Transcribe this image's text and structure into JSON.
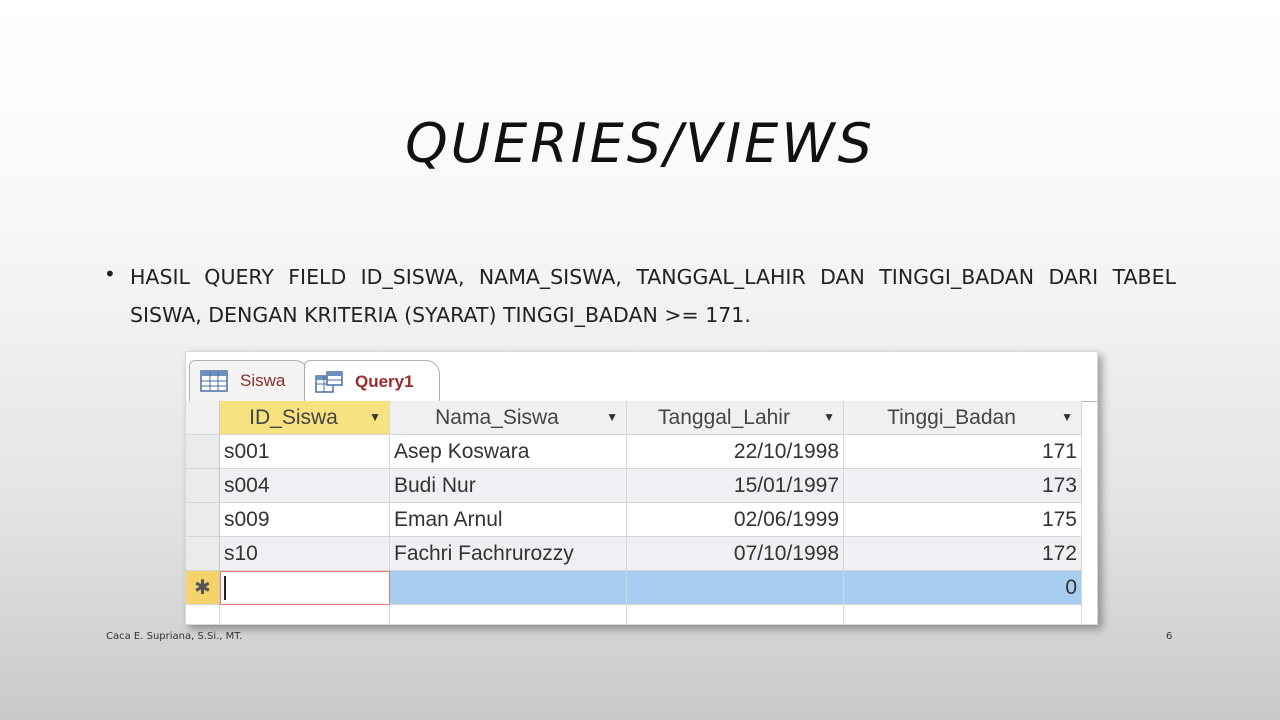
{
  "slide": {
    "title": "QUERIES/VIEWS",
    "bullet": "HASIL QUERY FIELD ID_SISWA, NAMA_SISWA, TANGGAL_LAHIR DAN TINGGI_BADAN DARI TABEL SISWA, DENGAN KRITERIA (SYARAT) TINGGI_BADAN >= 171.",
    "footer_author": "Caca E. Supriana, S.Si., MT.",
    "page_number": "6"
  },
  "access": {
    "tabs": [
      {
        "label": "Siswa",
        "icon": "table-icon"
      },
      {
        "label": "Query1",
        "icon": "query-icon"
      }
    ],
    "columns": [
      "ID_Siswa",
      "Nama_Siswa",
      "Tanggal_Lahir",
      "Tinggi_Badan"
    ],
    "rows": [
      {
        "id": "s001",
        "nama": "Asep Koswara",
        "tanggal": "22/10/1998",
        "tinggi": "171"
      },
      {
        "id": "s004",
        "nama": "Budi Nur",
        "tanggal": "15/01/1997",
        "tinggi": "173"
      },
      {
        "id": "s009",
        "nama": "Eman Arnul",
        "tanggal": "02/06/1999",
        "tinggi": "175"
      },
      {
        "id": "s10",
        "nama": "Fachri Fachrurozzy",
        "tanggal": "07/10/1998",
        "tinggi": "172"
      }
    ],
    "new_record": {
      "marker": "✱",
      "tinggi_default": "0"
    },
    "colors": {
      "tab_text": "#9b2b2b",
      "header_selected": "#f8e27f",
      "new_row": "#a7cdf0",
      "new_row_selector": "#f5d36b"
    }
  }
}
